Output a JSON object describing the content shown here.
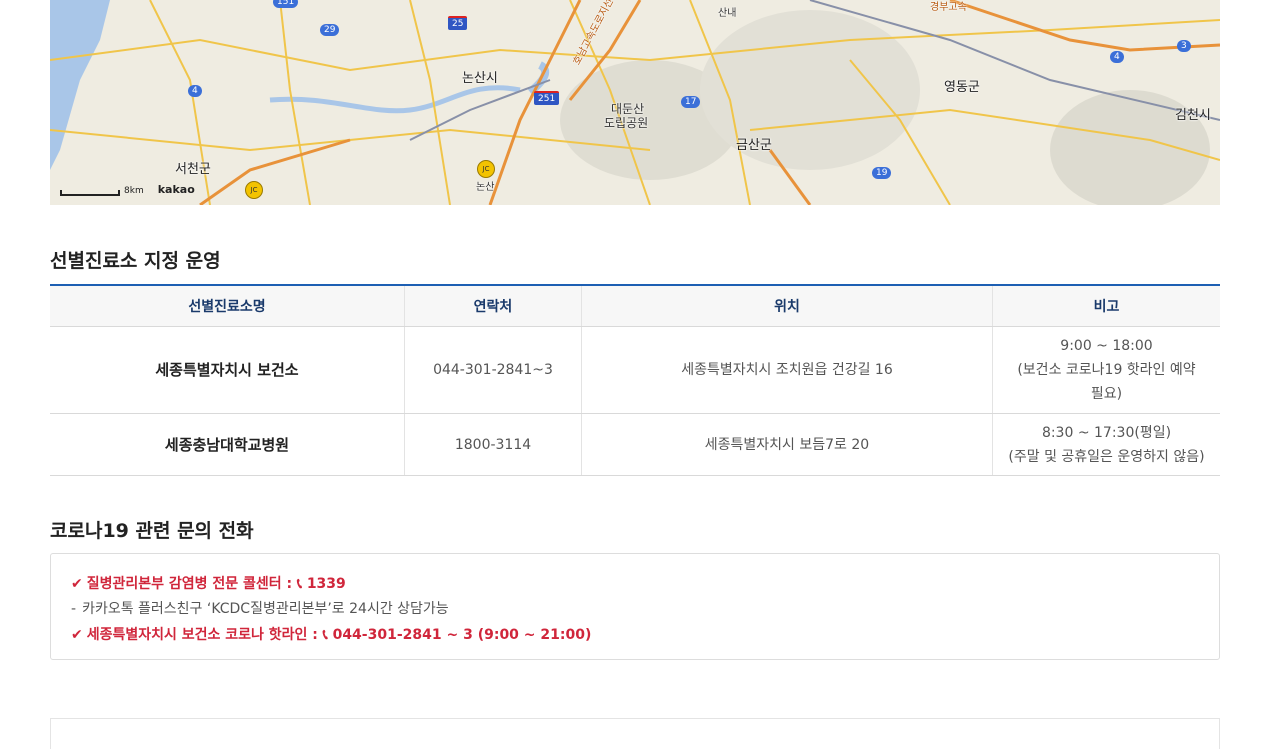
{
  "map": {
    "labels": {
      "nonsan_city": "논산시",
      "seocheon": "서천군",
      "daedunsan": "대둔산",
      "daedunsan2": "도립공원",
      "geumsan": "금산군",
      "yeongdong": "영동군",
      "gimcheon": "김천시",
      "nonsan": "논산",
      "sannae": "산내",
      "expressway": "호남고속도로지선",
      "gyeongbu": "경부고속"
    },
    "routes": {
      "r151": "151",
      "r29": "29",
      "r25": "25",
      "r4a": "4",
      "r251": "251",
      "r17": "17",
      "r19": "19",
      "r4b": "4",
      "r3": "3"
    },
    "jc": "JC",
    "scale_text": "8km",
    "brand": "kakao"
  },
  "clinics": {
    "title": "선별진료소 지정 운영",
    "headers": [
      "선별진료소명",
      "연락처",
      "위치",
      "비고"
    ],
    "rows": [
      {
        "name": "세종특별자치시 보건소",
        "phone": "044-301-2841~3",
        "location": "세종특별자치시 조치원읍 건강길 16",
        "note_line1": "9:00 ~ 18:00",
        "note_line2": "(보건소 코로나19 핫라인 예약",
        "note_line3": "필요)"
      },
      {
        "name": "세종충남대학교병원",
        "phone": "1800-3114",
        "location": "세종특별자치시 보듬7로 20",
        "note_line1": "8:30 ~ 17:30(평일)",
        "note_line2": "(주말 및 공휴일은 운영하지 않음)"
      }
    ]
  },
  "hotline": {
    "title": "코로나19 관련 문의 전화",
    "line1": "질병관리본부 감염병 전문 콜센터 : ",
    "line1_number": "1339",
    "line2": "카카오톡 플러스친구 ‘KCDC질병관리본부’로 24시간 상담가능",
    "line3": "세종특별자치시 보건소 코로나 핫라인 : ",
    "line3_number": "044-301-2841 ~ 3 (9:00 ~ 21:00)"
  },
  "colors": {
    "accent_blue": "#1d5fb3",
    "alert_red": "#d0263b"
  }
}
